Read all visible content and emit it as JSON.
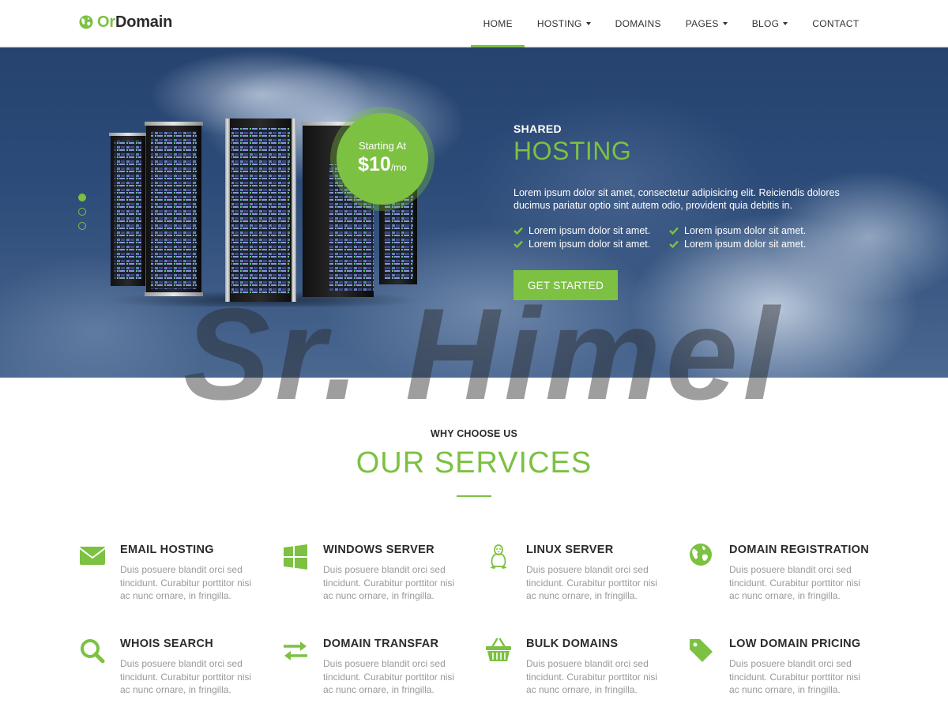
{
  "brand": {
    "name_part1": "Or",
    "name_part2": "Domain",
    "icon": "globe-icon"
  },
  "nav": {
    "items": [
      {
        "label": "HOME",
        "active": true,
        "dropdown": false
      },
      {
        "label": "HOSTING",
        "active": false,
        "dropdown": true
      },
      {
        "label": "DOMAINS",
        "active": false,
        "dropdown": false
      },
      {
        "label": "PAGES",
        "active": false,
        "dropdown": true
      },
      {
        "label": "BLOG",
        "active": false,
        "dropdown": true
      },
      {
        "label": "CONTACT",
        "active": false,
        "dropdown": false
      }
    ]
  },
  "hero": {
    "badge_top": "Starting At",
    "badge_price": "$10",
    "badge_period": "/mo",
    "kicker": "SHARED",
    "title": "HOSTING",
    "description": "Lorem ipsum dolor sit amet, consectetur adipisicing elit. Reiciendis dolores ducimus pariatur optio sint autem odio, provident quia debitis in.",
    "features": [
      "Lorem ipsum dolor sit amet.",
      "Lorem ipsum dolor sit amet.",
      "Lorem ipsum dolor sit amet.",
      "Lorem ipsum dolor sit amet."
    ],
    "cta_label": "GET STARTED",
    "slides_total": 3,
    "slide_active": 1
  },
  "watermark": "Sr. Himel",
  "services_section": {
    "kicker": "WHY CHOOSE US",
    "title": "OUR SERVICES",
    "items": [
      {
        "icon": "envelope-icon",
        "title": "EMAIL HOSTING",
        "desc": "Duis posuere blandit orci sed tincidunt. Curabitur porttitor nisi ac nunc ornare, in fringilla."
      },
      {
        "icon": "windows-icon",
        "title": "WINDOWS SERVER",
        "desc": "Duis posuere blandit orci sed tincidunt. Curabitur porttitor nisi ac nunc ornare, in fringilla."
      },
      {
        "icon": "linux-icon",
        "title": "LINUX SERVER",
        "desc": "Duis posuere blandit orci sed tincidunt. Curabitur porttitor nisi ac nunc ornare, in fringilla."
      },
      {
        "icon": "globe-icon",
        "title": "DOMAIN REGISTRATION",
        "desc": "Duis posuere blandit orci sed tincidunt. Curabitur porttitor nisi ac nunc ornare, in fringilla."
      },
      {
        "icon": "search-icon",
        "title": "WHOIS SEARCH",
        "desc": "Duis posuere blandit orci sed tincidunt. Curabitur porttitor nisi ac nunc ornare, in fringilla."
      },
      {
        "icon": "transfer-icon",
        "title": "DOMAIN TRANSFAR",
        "desc": "Duis posuere blandit orci sed tincidunt. Curabitur porttitor nisi ac nunc ornare, in fringilla."
      },
      {
        "icon": "basket-icon",
        "title": "BULK DOMAINS",
        "desc": "Duis posuere blandit orci sed tincidunt. Curabitur porttitor nisi ac nunc ornare, in fringilla."
      },
      {
        "icon": "tag-icon",
        "title": "LOW DOMAIN PRICING",
        "desc": "Duis posuere blandit orci sed tincidunt. Curabitur porttitor nisi ac nunc ornare, in fringilla."
      }
    ]
  },
  "colors": {
    "accent": "#7cc142",
    "text_dark": "#2b2b2b",
    "text_muted": "#999999",
    "hero_sky": "#2c4b78"
  }
}
